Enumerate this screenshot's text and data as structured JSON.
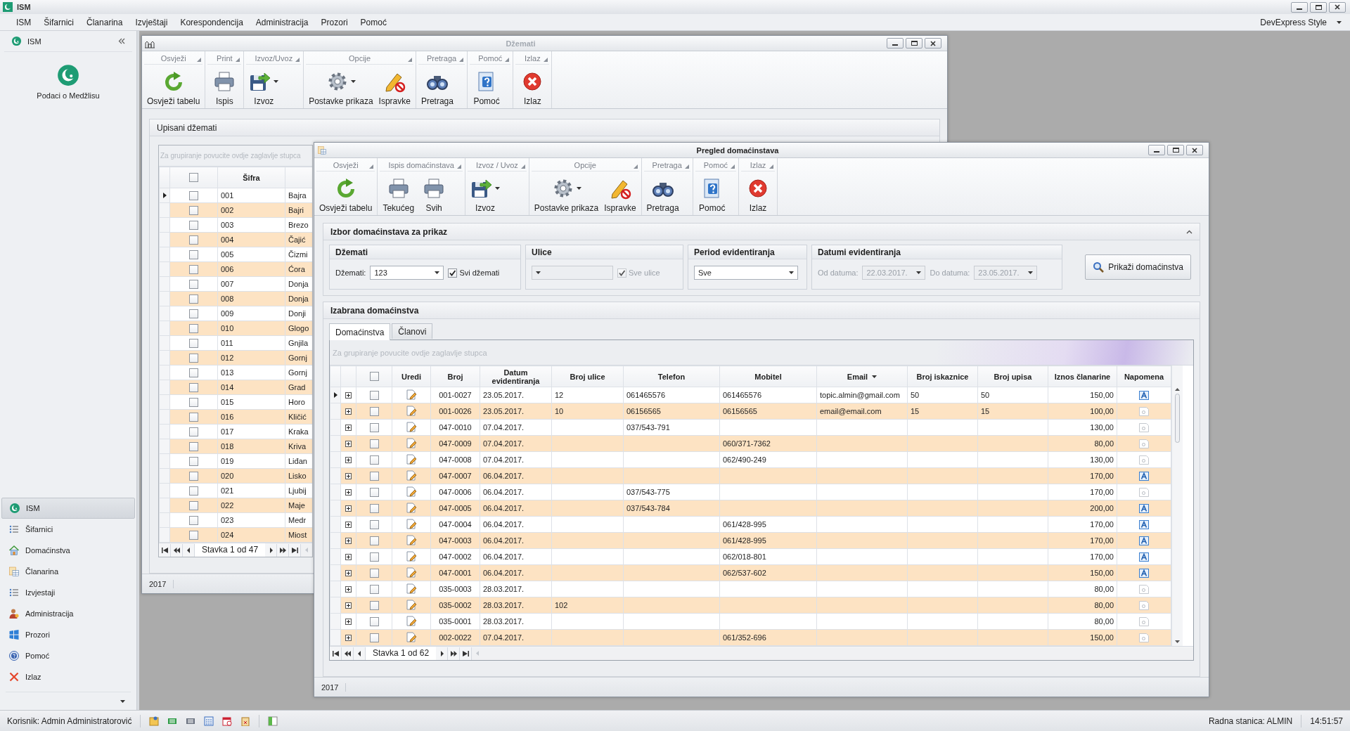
{
  "app": {
    "title": "ISM",
    "menu": [
      "ISM",
      "Šifarnici",
      "Članarina",
      "Izvještaji",
      "Korespondencija",
      "Administracija",
      "Prozori",
      "Pomoć"
    ],
    "skin": "DevExpress Style"
  },
  "sidebar": {
    "title": "ISM",
    "top_item": "Podaci o Medžlisu",
    "items": [
      {
        "label": "ISM",
        "kind": "logo",
        "selected": true
      },
      {
        "label": "Šifarnici",
        "kind": "list",
        "selected": false
      },
      {
        "label": "Domaćinstva",
        "kind": "house",
        "selected": false
      },
      {
        "label": "Članarina",
        "kind": "table",
        "selected": false
      },
      {
        "label": "Izvjestaji",
        "kind": "list",
        "selected": false
      },
      {
        "label": "Administracija",
        "kind": "person",
        "selected": false
      },
      {
        "label": "Prozori",
        "kind": "tiles",
        "selected": false
      },
      {
        "label": "Pomoć",
        "kind": "help",
        "selected": false
      },
      {
        "label": "Izlaz",
        "kind": "cross",
        "selected": false
      }
    ]
  },
  "dzemati_window": {
    "title": "Džemati",
    "ribbon": [
      {
        "group": "Osvježi",
        "buttons": [
          {
            "label": "Osvježi tabelu",
            "kind": "refresh"
          }
        ]
      },
      {
        "group": "Print",
        "buttons": [
          {
            "label": "Ispis",
            "kind": "print"
          }
        ]
      },
      {
        "group": "Izvoz/Uvoz",
        "buttons": [
          {
            "label": "Izvoz",
            "kind": "export",
            "dropdown": true
          }
        ]
      },
      {
        "group": "Opcije",
        "buttons": [
          {
            "label": "Postavke prikaza",
            "kind": "settings",
            "dropdown": true
          },
          {
            "label": "Ispravke",
            "kind": "edit"
          }
        ]
      },
      {
        "group": "Pretraga",
        "buttons": [
          {
            "label": "Pretraga",
            "kind": "binoculars"
          }
        ]
      },
      {
        "group": "Pomoć",
        "buttons": [
          {
            "label": "Pomoć",
            "kind": "help"
          }
        ]
      },
      {
        "group": "Izlaz",
        "buttons": [
          {
            "label": "Izlaz",
            "kind": "exit"
          }
        ]
      }
    ],
    "panel_title": "Upisani džemati",
    "group_hint": "Za grupiranje povucite ovdje zaglavlje stupca",
    "header_checked": false,
    "columns": [
      "Šifra"
    ],
    "rows": [
      {
        "sifra": "001",
        "naziv": "Bajra",
        "checked": false,
        "current": true
      },
      {
        "sifra": "002",
        "naziv": "Bajri",
        "checked": false,
        "current": false
      },
      {
        "sifra": "003",
        "naziv": "Brezo",
        "checked": false,
        "current": false
      },
      {
        "sifra": "004",
        "naziv": "Čajić",
        "checked": false,
        "current": false
      },
      {
        "sifra": "005",
        "naziv": "Čizmi",
        "checked": false,
        "current": false
      },
      {
        "sifra": "006",
        "naziv": "Ćora",
        "checked": false,
        "current": false
      },
      {
        "sifra": "007",
        "naziv": "Donja",
        "checked": false,
        "current": false
      },
      {
        "sifra": "008",
        "naziv": "Donja",
        "checked": false,
        "current": false
      },
      {
        "sifra": "009",
        "naziv": "Donji",
        "checked": false,
        "current": false
      },
      {
        "sifra": "010",
        "naziv": "Glogo",
        "checked": false,
        "current": false
      },
      {
        "sifra": "011",
        "naziv": "Gnjila",
        "checked": false,
        "current": false
      },
      {
        "sifra": "012",
        "naziv": "Gornj",
        "checked": false,
        "current": false
      },
      {
        "sifra": "013",
        "naziv": "Gornj",
        "checked": false,
        "current": false
      },
      {
        "sifra": "014",
        "naziv": "Grad",
        "checked": false,
        "current": false
      },
      {
        "sifra": "015",
        "naziv": "Horo",
        "checked": false,
        "current": false
      },
      {
        "sifra": "016",
        "naziv": "Kličić",
        "checked": false,
        "current": false
      },
      {
        "sifra": "017",
        "naziv": "Kraka",
        "checked": false,
        "current": false
      },
      {
        "sifra": "018",
        "naziv": "Kriva",
        "checked": false,
        "current": false
      },
      {
        "sifra": "019",
        "naziv": "Liđan",
        "checked": false,
        "current": false
      },
      {
        "sifra": "020",
        "naziv": "Lisko",
        "checked": false,
        "current": false
      },
      {
        "sifra": "021",
        "naziv": "Ljubij",
        "checked": false,
        "current": false
      },
      {
        "sifra": "022",
        "naziv": "Maje",
        "checked": false,
        "current": false
      },
      {
        "sifra": "023",
        "naziv": "Medr",
        "checked": false,
        "current": false
      },
      {
        "sifra": "024",
        "naziv": "Miost",
        "checked": false,
        "current": false
      }
    ],
    "navigator": "Stavka 1 od 47",
    "footer": "2017"
  },
  "domacinstva_window": {
    "title": "Pregled domaćinstava",
    "ribbon": [
      {
        "group": "Osvježi",
        "buttons": [
          {
            "label": "Osvježi tabelu",
            "kind": "refresh"
          }
        ]
      },
      {
        "group": "Ispis domaćinstava",
        "buttons": [
          {
            "label": "Tekućeg",
            "kind": "print"
          },
          {
            "label": "Svih",
            "kind": "print"
          }
        ]
      },
      {
        "group": "Izvoz / Uvoz",
        "buttons": [
          {
            "label": "Izvoz",
            "kind": "export",
            "dropdown": true
          }
        ]
      },
      {
        "group": "Opcije",
        "buttons": [
          {
            "label": "Postavke prikaza",
            "kind": "settings",
            "dropdown": true
          },
          {
            "label": "Ispravke",
            "kind": "edit"
          }
        ]
      },
      {
        "group": "Pretraga",
        "buttons": [
          {
            "label": "Pretraga",
            "kind": "binoculars"
          }
        ]
      },
      {
        "group": "Pomoć",
        "buttons": [
          {
            "label": "Pomoć",
            "kind": "help"
          }
        ]
      },
      {
        "group": "Izlaz",
        "buttons": [
          {
            "label": "Izlaz",
            "kind": "exit"
          }
        ]
      }
    ],
    "filter": {
      "title": "Izbor domaćinstava za prikaz",
      "dzemati": {
        "title": "Džemati",
        "label": "Džemati:",
        "value": "123",
        "all_label": "Svi džemati",
        "all_checked": true
      },
      "ulice": {
        "title": "Ulice",
        "all_label": "Sve ulice",
        "all_checked": true,
        "disabled": true
      },
      "period": {
        "title": "Period evidentiranja",
        "value": "Sve"
      },
      "datumi": {
        "title": "Datumi evidentiranja",
        "from_label": "Od datuma:",
        "from": "22.03.2017.",
        "to_label": "Do datuma:",
        "to": "23.05.2017.",
        "disabled": true
      },
      "button": "Prikaži domaćinstva"
    },
    "results_title": "Izabrana domaćinstva",
    "tabs": [
      {
        "label": "Domaćinstva",
        "selected": true
      },
      {
        "label": "Članovi",
        "selected": false
      }
    ],
    "group_hint": "Za grupiranje povucite ovdje zaglavlje stupca",
    "header_checked": false,
    "columns": [
      {
        "label": "Uredi"
      },
      {
        "label": "Broj"
      },
      {
        "label": "Datum evidentiranja"
      },
      {
        "label": "Broj ulice"
      },
      {
        "label": "Telefon"
      },
      {
        "label": "Mobitel"
      },
      {
        "label": "Email",
        "dropdown": true
      },
      {
        "label": "Broj iskaznice"
      },
      {
        "label": "Broj upisa"
      },
      {
        "label": "Iznos članarine"
      },
      {
        "label": "Napomena"
      }
    ],
    "rows": [
      {
        "broj": "001-0027",
        "datum": "23.05.2017.",
        "broj_ulice": "12",
        "telefon": "061465576",
        "mobitel": "061465576",
        "email": "topic.almin@gmail.com",
        "broj_iskaznice": "50",
        "broj_upisa": "50",
        "iznos": "150,00",
        "has_note": true,
        "checked": false,
        "current": true
      },
      {
        "broj": "001-0026",
        "datum": "23.05.2017.",
        "broj_ulice": "10",
        "telefon": "06156565",
        "mobitel": "06156565",
        "email": "email@email.com",
        "broj_iskaznice": "15",
        "broj_upisa": "15",
        "iznos": "100,00",
        "has_note": false,
        "checked": false,
        "current": false
      },
      {
        "broj": "047-0010",
        "datum": "07.04.2017.",
        "telefon": "037/543-791",
        "iznos": "130,00",
        "has_note": false,
        "checked": false,
        "current": false
      },
      {
        "broj": "047-0009",
        "datum": "07.04.2017.",
        "mobitel": "060/371-7362",
        "iznos": "80,00",
        "has_note": false,
        "checked": false,
        "current": false
      },
      {
        "broj": "047-0008",
        "datum": "07.04.2017.",
        "mobitel": "062/490-249",
        "iznos": "130,00",
        "has_note": false,
        "checked": false,
        "current": false
      },
      {
        "broj": "047-0007",
        "datum": "06.04.2017.",
        "iznos": "170,00",
        "has_note": true,
        "checked": false,
        "current": false
      },
      {
        "broj": "047-0006",
        "datum": "06.04.2017.",
        "telefon": "037/543-775",
        "iznos": "170,00",
        "has_note": false,
        "checked": false,
        "current": false
      },
      {
        "broj": "047-0005",
        "datum": "06.04.2017.",
        "telefon": "037/543-784",
        "iznos": "200,00",
        "has_note": true,
        "checked": false,
        "current": false
      },
      {
        "broj": "047-0004",
        "datum": "06.04.2017.",
        "mobitel": "061/428-995",
        "iznos": "170,00",
        "has_note": true,
        "checked": false,
        "current": false
      },
      {
        "broj": "047-0003",
        "datum": "06.04.2017.",
        "mobitel": "061/428-995",
        "iznos": "170,00",
        "has_note": true,
        "checked": false,
        "current": false
      },
      {
        "broj": "047-0002",
        "datum": "06.04.2017.",
        "mobitel": "062/018-801",
        "iznos": "170,00",
        "has_note": true,
        "checked": false,
        "current": false
      },
      {
        "broj": "047-0001",
        "datum": "06.04.2017.",
        "mobitel": "062/537-602",
        "iznos": "150,00",
        "has_note": true,
        "checked": false,
        "current": false
      },
      {
        "broj": "035-0003",
        "datum": "28.03.2017.",
        "iznos": "80,00",
        "has_note": false,
        "checked": false,
        "current": false
      },
      {
        "broj": "035-0002",
        "datum": "28.03.2017.",
        "broj_ulice": "102",
        "iznos": "80,00",
        "has_note": false,
        "checked": false,
        "current": false
      },
      {
        "broj": "035-0001",
        "datum": "28.03.2017.",
        "iznos": "80,00",
        "has_note": false,
        "checked": false,
        "current": false
      },
      {
        "broj": "002-0022",
        "datum": "07.04.2017.",
        "mobitel": "061/352-696",
        "iznos": "150,00",
        "has_note": false,
        "checked": false,
        "current": false
      }
    ],
    "navigator": "Stavka 1 od 62",
    "footer": "2017"
  },
  "status_bar": {
    "user": "Korisnik: Admin Administratorović",
    "workstation": "Radna stanica: ALMIN",
    "time": "14:51:57"
  }
}
